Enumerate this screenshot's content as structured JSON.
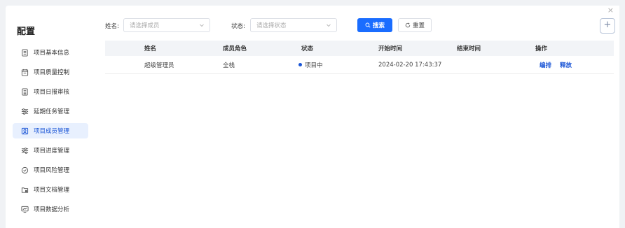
{
  "sidebar": {
    "title": "配置",
    "items": [
      {
        "label": "项目基本信息",
        "icon": "document-list-icon"
      },
      {
        "label": "项目质量控制",
        "icon": "calendar-icon"
      },
      {
        "label": "项目日报审核",
        "icon": "report-icon"
      },
      {
        "label": "延期任务管理",
        "icon": "sliders-icon"
      },
      {
        "label": "项目成员管理",
        "icon": "member-icon",
        "active": true
      },
      {
        "label": "项目进度管理",
        "icon": "sliders-icon"
      },
      {
        "label": "项目风险管理",
        "icon": "shield-check-icon"
      },
      {
        "label": "项目文档管理",
        "icon": "folder-icon"
      },
      {
        "label": "项目数据分析",
        "icon": "monitor-chart-icon"
      }
    ]
  },
  "filters": {
    "name_label": "姓名:",
    "name_placeholder": "请选择成员",
    "status_label": "状态:",
    "status_placeholder": "请选择状态",
    "search_label": "搜索",
    "reset_label": "重置"
  },
  "controls": {
    "close": "×",
    "add": "+"
  },
  "table": {
    "columns": [
      "姓名",
      "成员角色",
      "状态",
      "开始时间",
      "结束时间",
      "操作"
    ],
    "rows": [
      {
        "name": "超级管理员",
        "role": "全栈",
        "status": "项目中",
        "start_time": "2024-02-20 17:43:37",
        "end_time": "",
        "actions": [
          "编排",
          "释放"
        ]
      }
    ]
  },
  "colors": {
    "accent": "#1a6dff",
    "active_bg": "#e8f0fe",
    "active_text": "#1a55d6",
    "status_dot": "#1a55d6"
  }
}
